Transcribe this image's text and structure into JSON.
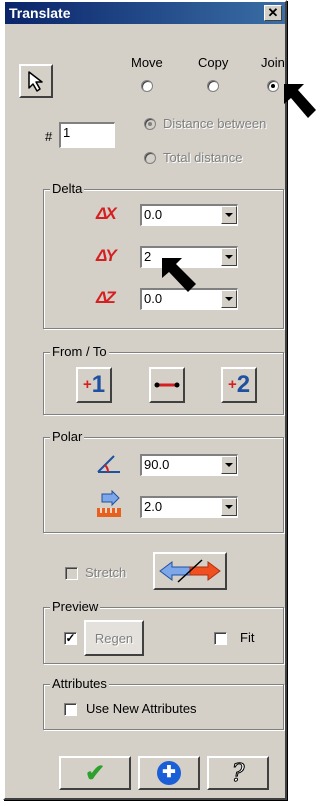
{
  "window": {
    "title": "Translate",
    "close_glyph": "✕"
  },
  "mode": {
    "options": [
      {
        "label": "Move",
        "checked": false
      },
      {
        "label": "Copy",
        "checked": false
      },
      {
        "label": "Join",
        "checked": true
      }
    ]
  },
  "count": {
    "label": "#",
    "value": "1"
  },
  "distance": {
    "between": "Distance between",
    "total": "Total distance"
  },
  "delta": {
    "title": "Delta",
    "rows": [
      {
        "axis": "ΔX",
        "value": "0.0"
      },
      {
        "axis": "ΔY",
        "value": "2"
      },
      {
        "axis": "ΔZ",
        "value": "0.0"
      }
    ]
  },
  "from_to": {
    "title": "From / To",
    "btn1": "1",
    "btn2": "2"
  },
  "polar": {
    "title": "Polar",
    "angle": "90.0",
    "distance": "2.0"
  },
  "stretch": {
    "label": "Stretch"
  },
  "preview": {
    "title": "Preview",
    "regen": "Regen",
    "fit": "Fit",
    "checked": true
  },
  "attributes": {
    "title": "Attributes",
    "use_new": "Use New Attributes"
  },
  "footer": {
    "ok": "✔",
    "apply": "✚",
    "help": "?"
  },
  "colors": {
    "accent_red": "#d42020",
    "ok_green": "#2ea02e",
    "apply_blue": "#1a5fd8",
    "title_blue": "#0a246a"
  }
}
